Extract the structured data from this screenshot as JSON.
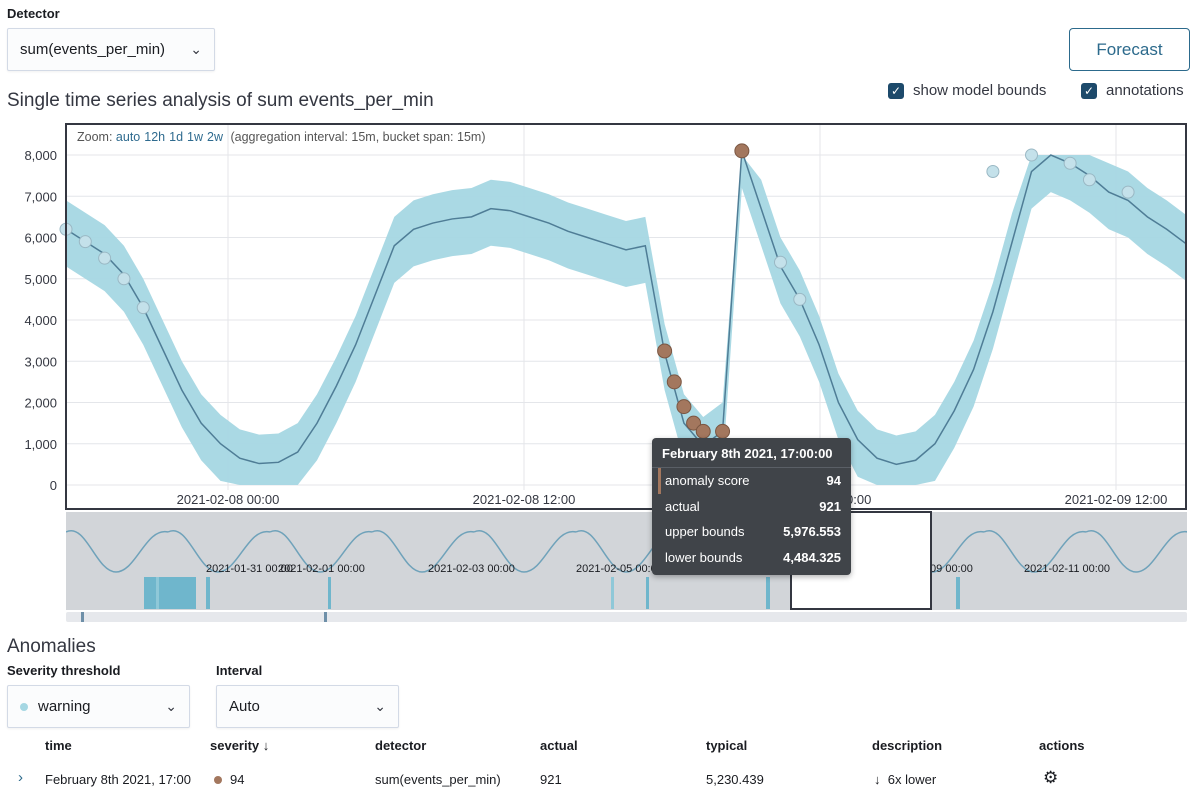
{
  "detector": {
    "label": "Detector",
    "value": "sum(events_per_min)"
  },
  "forecast_button": "Forecast",
  "checkboxes": {
    "model_bounds": "show model bounds",
    "annotations": "annotations"
  },
  "chart_title": "Single time series analysis of sum events_per_min",
  "zoom": {
    "prefix": "Zoom:",
    "options": [
      "auto",
      "12h",
      "1d",
      "1w",
      "2w"
    ],
    "info": "(aggregation interval: 15m, bucket span: 15m)"
  },
  "colors": {
    "bounds": "#a5d7e3",
    "line": "#4f7d96",
    "anomaly": "#a3775e",
    "marker": "#c4e1ea"
  },
  "chart_data": {
    "type": "line",
    "y_ticks": [
      "8,000",
      "7,000",
      "6,000",
      "5,000",
      "4,000",
      "3,000",
      "2,000",
      "1,000",
      "0"
    ],
    "x_ticks": [
      "2021-02-08 00:00",
      "2021-02-08 12:00",
      "2021-02-09 00:00",
      "2021-02-09 12:00"
    ],
    "ylim": [
      0,
      8200
    ],
    "series": [
      {
        "points": [
          [
            0,
            6200
          ],
          [
            1,
            5900
          ],
          [
            2,
            5600
          ],
          [
            3,
            5100
          ],
          [
            4,
            4300
          ],
          [
            5,
            3300
          ],
          [
            6,
            2300
          ],
          [
            7,
            1500
          ],
          [
            8,
            1000
          ],
          [
            9,
            650
          ],
          [
            10,
            520
          ],
          [
            11,
            550
          ],
          [
            12,
            800
          ],
          [
            13,
            1500
          ],
          [
            14,
            2400
          ],
          [
            15,
            3400
          ],
          [
            16,
            4600
          ],
          [
            17,
            5800
          ],
          [
            18,
            6200
          ],
          [
            19,
            6350
          ],
          [
            20,
            6450
          ],
          [
            21,
            6500
          ],
          [
            22,
            6700
          ],
          [
            23,
            6650
          ],
          [
            24,
            6500
          ],
          [
            25,
            6350
          ],
          [
            26,
            6150
          ],
          [
            27,
            6000
          ],
          [
            28,
            5850
          ],
          [
            29,
            5700
          ],
          [
            30,
            5800
          ],
          [
            31,
            3200
          ],
          [
            32,
            1500
          ],
          [
            33,
            950
          ],
          [
            34,
            1300
          ],
          [
            35,
            8100
          ],
          [
            36,
            6700
          ],
          [
            37,
            5300
          ],
          [
            38,
            4500
          ],
          [
            39,
            3400
          ],
          [
            40,
            2000
          ],
          [
            41,
            1100
          ],
          [
            42,
            650
          ],
          [
            43,
            500
          ],
          [
            44,
            600
          ],
          [
            45,
            1000
          ],
          [
            46,
            1800
          ],
          [
            47,
            2800
          ],
          [
            48,
            4200
          ],
          [
            49,
            5900
          ],
          [
            50,
            7600
          ],
          [
            51,
            8000
          ],
          [
            52,
            7800
          ],
          [
            53,
            7500
          ],
          [
            54,
            7100
          ],
          [
            55,
            6900
          ],
          [
            56,
            6500
          ],
          [
            57,
            6200
          ],
          [
            58,
            5850
          ]
        ]
      }
    ],
    "anomaly_points": [
      [
        31,
        3250
      ],
      [
        31.5,
        2500
      ],
      [
        32,
        1900
      ],
      [
        32.5,
        1500
      ],
      [
        33,
        1300
      ],
      [
        33.5,
        950
      ],
      [
        34,
        1300
      ],
      [
        35,
        8100
      ]
    ],
    "overview_ticks": [
      "2021-01-31 00:00",
      "2021-02-01 00:00",
      "2021-02-03 00:00",
      "2021-02-05 00:00",
      "2021-02-09 00:00",
      "2021-02-11 00:00"
    ]
  },
  "tooltip": {
    "title": "February 8th 2021, 17:00:00",
    "rows": [
      {
        "label": "anomaly score",
        "value": "94"
      },
      {
        "label": "actual",
        "value": "921"
      },
      {
        "label": "upper bounds",
        "value": "5,976.553"
      },
      {
        "label": "lower bounds",
        "value": "4,484.325"
      }
    ]
  },
  "anomalies": {
    "title": "Anomalies",
    "severity_label": "Severity threshold",
    "severity_value": "warning",
    "interval_label": "Interval",
    "interval_value": "Auto",
    "columns": [
      "time",
      "severity",
      "detector",
      "actual",
      "typical",
      "description",
      "actions"
    ],
    "row": {
      "time": "February 8th 2021, 17:00",
      "severity": "94",
      "detector": "sum(events_per_min)",
      "actual": "921",
      "typical": "5,230.439",
      "description": "6x lower"
    }
  }
}
